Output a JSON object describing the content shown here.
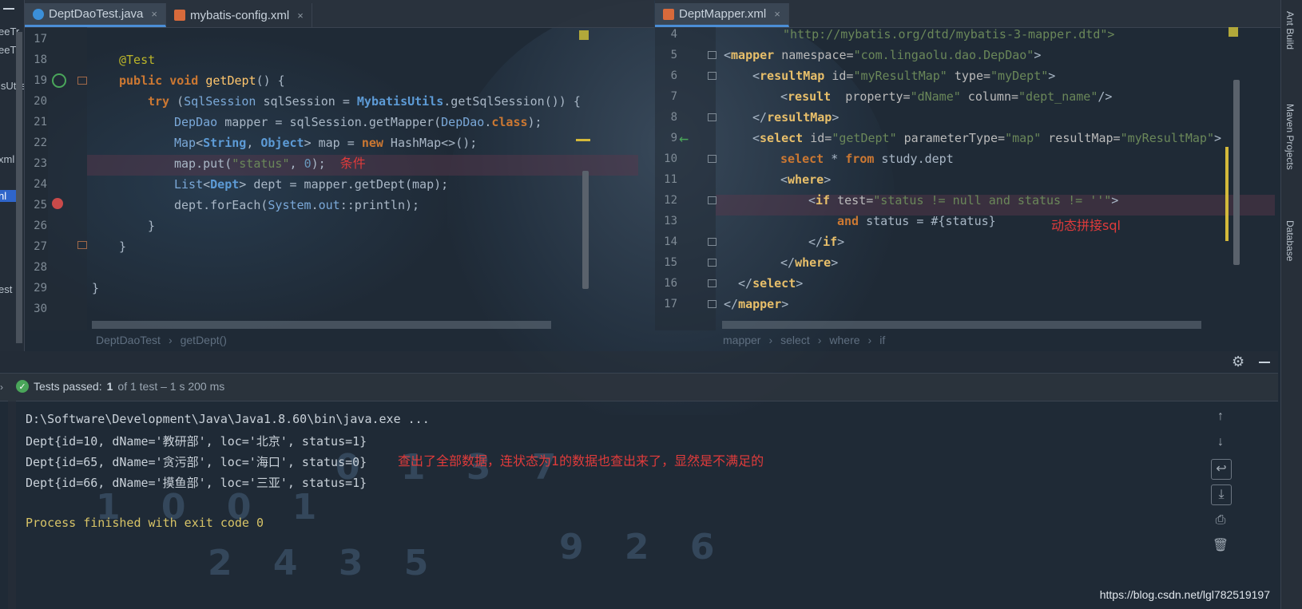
{
  "tabs_left": [
    {
      "label": "DeptDaoTest.java",
      "icon": "java-class-icon",
      "active": true
    },
    {
      "label": "mybatis-config.xml",
      "icon": "xml-file-icon",
      "active": false
    }
  ],
  "tab_right": {
    "label": "DeptMapper.xml",
    "icon": "xml-file-icon"
  },
  "close_glyph": "×",
  "left_strip_items": [
    "eeTr",
    "eeTr",
    "isUtils",
    "xml",
    "nl",
    "est"
  ],
  "java_lines": [
    {
      "n": "17"
    },
    {
      "n": "18"
    },
    {
      "n": "19"
    },
    {
      "n": "20"
    },
    {
      "n": "21"
    },
    {
      "n": "22"
    },
    {
      "n": "23"
    },
    {
      "n": "24"
    },
    {
      "n": "25"
    },
    {
      "n": "26"
    },
    {
      "n": "27"
    },
    {
      "n": "28"
    },
    {
      "n": "29"
    },
    {
      "n": "30"
    }
  ],
  "java": {
    "l18": "@Test",
    "l19a": "public void ",
    "l19b": "getDept",
    "l19c": "() {",
    "l20a": "try ",
    "l20b": "(",
    "l20c": "SqlSession",
    "l20d": " sqlSession = ",
    "l20e": "MybatisUtils",
    "l20f": ".getSqlSession()) {",
    "l21a": "DepDao",
    "l21b": " mapper = sqlSession.getMapper(",
    "l21c": "DepDao",
    "l21d": ".",
    "l21e": "class",
    "l21f": ");",
    "l22a": "Map",
    "l22b": "<",
    "l22c": "String",
    "l22d": ", ",
    "l22e": "Object",
    "l22f": "> map = ",
    "l22g": "new",
    "l22h": " HashMap<>();",
    "l23a": "map.put(",
    "l23b": "\"status\"",
    "l23c": ", ",
    "l23d": "0",
    "l23e": ");",
    "l23note": "条件",
    "l24a": "List",
    "l24b": "<",
    "l24c": "Dept",
    "l24d": "> dept = mapper.getDept(map);",
    "l25a": "dept.forEach(",
    "l25b": "System",
    "l25c": ".",
    "l25d": "out",
    "l25e": "::println);",
    "l26": "}",
    "l27": "}",
    "l29": "}"
  },
  "xml_lines": [
    "4",
    "5",
    "6",
    "7",
    "8",
    "9",
    "10",
    "11",
    "12",
    "13",
    "14",
    "15",
    "16",
    "17"
  ],
  "xml": {
    "l4": "\"http://mybatis.org/dtd/mybatis-3-mapper.dtd\">",
    "l5a": "<",
    "l5b": "mapper",
    "l5c": " namespace=",
    "l5d": "\"com.lingaolu.dao.DepDao\"",
    "l5e": ">",
    "l6a": "<",
    "l6b": "resultMap",
    "l6c": " id=",
    "l6d": "\"myResultMap\"",
    "l6e": " type=",
    "l6f": "\"myDept\"",
    "l6g": ">",
    "l7a": "<",
    "l7b": "result",
    "l7c": "  property=",
    "l7d": "\"dName\"",
    "l7e": " column=",
    "l7f": "\"dept_name\"",
    "l7g": "/>",
    "l8a": "</",
    "l8b": "resultMap",
    "l8c": ">",
    "l9a": "<",
    "l9b": "select",
    "l9c": " id=",
    "l9d": "\"getDept\"",
    "l9e": " parameterType=",
    "l9f": "\"map\"",
    "l9g": " resultMap=",
    "l9h": "\"myResultMap\"",
    "l9i": ">",
    "l10a": "select",
    "l10b": " * ",
    "l10c": "from",
    "l10d": " study.dept",
    "l11a": "<",
    "l11b": "where",
    "l11c": ">",
    "l12a": "<",
    "l12b": "if",
    "l12c": " test=",
    "l12d": "\"status != null and status != ''\"",
    "l12e": ">",
    "l13a": "and",
    "l13b": " status = #{status}",
    "l13note": "动态拼接sql",
    "l14a": "</",
    "l14b": "if",
    "l14c": ">",
    "l15a": "</",
    "l15b": "where",
    "l15c": ">",
    "l16a": "</",
    "l16b": "select",
    "l16c": ">",
    "l17a": "</",
    "l17b": "mapper",
    "l17c": ">"
  },
  "breadcrumb_left": [
    "DeptDaoTest",
    "getDept()"
  ],
  "breadcrumb_right": [
    "mapper",
    "select",
    "where",
    "if"
  ],
  "breadcrumb_sep": "›",
  "run": {
    "status_bold": "Tests passed:",
    "status_count": "1",
    "status_rest": "of 1 test – 1 s 200 ms",
    "lines": [
      "D:\\Software\\Development\\Java\\Java1.8.60\\bin\\java.exe ...",
      "Dept{id=10, dName='教研部', loc='北京', status=1}",
      "Dept{id=65, dName='贪污部', loc='海口', status=0}",
      "Dept{id=66, dName='摸鱼部', loc='三亚', status=1}",
      "",
      "Process finished with exit code 0"
    ],
    "note": "查出了全部数据，连状态为1的数据也查出来了，显然是不满足的"
  },
  "right_tools": [
    "Ant Build",
    "Maven Projects",
    "Database"
  ],
  "watermark": "https://blog.csdn.net/lgl782519197",
  "bg_digits": "0 1 2 3 7 5 9 4 2 3"
}
